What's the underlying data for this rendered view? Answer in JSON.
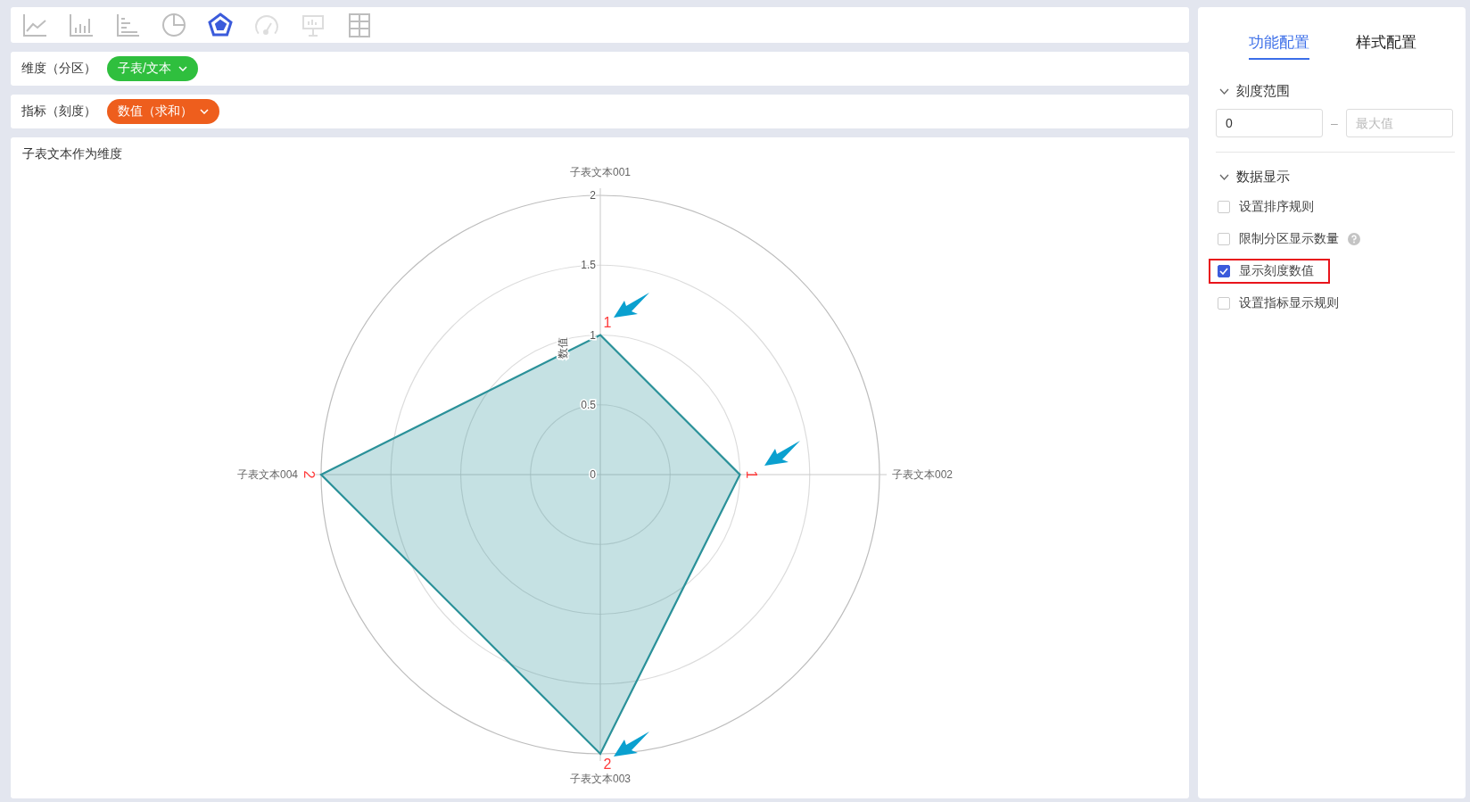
{
  "chart_types": [
    {
      "kind": "line",
      "selected": false,
      "disabled": false
    },
    {
      "kind": "bar",
      "selected": false,
      "disabled": false
    },
    {
      "kind": "hbar",
      "selected": false,
      "disabled": false
    },
    {
      "kind": "pie",
      "selected": false,
      "disabled": false
    },
    {
      "kind": "radar",
      "selected": true,
      "disabled": false
    },
    {
      "kind": "gauge",
      "selected": false,
      "disabled": true
    },
    {
      "kind": "board",
      "selected": false,
      "disabled": true
    },
    {
      "kind": "grid",
      "selected": false,
      "disabled": false
    }
  ],
  "fields": [
    {
      "label": "维度（分区）",
      "chip": "子表/文本",
      "color": "#2fbf3e"
    },
    {
      "label": "指标（刻度）",
      "chip": "数值（求和）",
      "color": "#ee5e1d"
    }
  ],
  "chart": {
    "title": "子表文本作为维度",
    "axis_title": "数值",
    "scale_labels": [
      "2",
      "1.5",
      "1",
      "0.5",
      "0"
    ],
    "spokes": [
      {
        "label": "子表文本001",
        "value_label": "1"
      },
      {
        "label": "子表文本002",
        "value_label": "1"
      },
      {
        "label": "子表文本003",
        "value_label": "2"
      },
      {
        "label": "子表文本004",
        "value_label": "2"
      }
    ]
  },
  "panel": {
    "tabs": [
      {
        "label": "功能配置",
        "selected": true
      },
      {
        "label": "样式配置",
        "selected": false
      }
    ],
    "sections": [
      {
        "title": "刻度范围",
        "expanded": true,
        "kind": "range",
        "min": "0",
        "separator": "–",
        "max_placeholder": "最大值"
      },
      {
        "title": "数据显示",
        "expanded": true,
        "kind": "options",
        "options": [
          {
            "label": "设置排序规则",
            "checked": false,
            "help": false,
            "highlighted": false
          },
          {
            "label": "限制分区显示数量",
            "checked": false,
            "help": true,
            "highlighted": false
          },
          {
            "label": "显示刻度数值",
            "checked": true,
            "help": false,
            "highlighted": true
          },
          {
            "label": "设置指标显示规则",
            "checked": false,
            "help": false,
            "highlighted": false
          }
        ]
      }
    ]
  }
}
